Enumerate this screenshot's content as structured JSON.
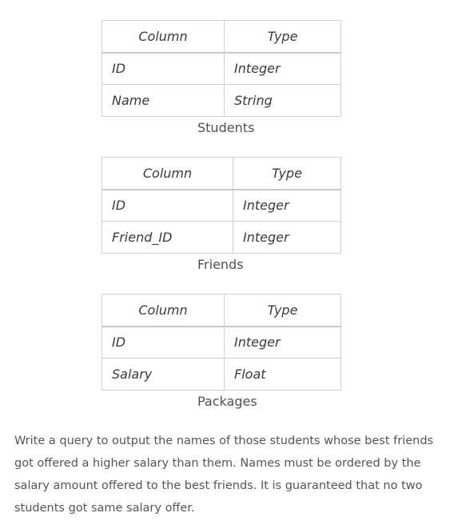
{
  "tables": [
    {
      "header": {
        "column": "Column",
        "type": "Type"
      },
      "rows": [
        {
          "column": "ID",
          "type": "Integer"
        },
        {
          "column": "Name",
          "type": "String"
        }
      ],
      "caption": "Students"
    },
    {
      "header": {
        "column": "Column",
        "type": "Type"
      },
      "rows": [
        {
          "column": "ID",
          "type": "Integer"
        },
        {
          "column": "Friend_ID",
          "type": "Integer"
        }
      ],
      "caption": "Friends"
    },
    {
      "header": {
        "column": "Column",
        "type": "Type"
      },
      "rows": [
        {
          "column": "ID",
          "type": "Integer"
        },
        {
          "column": "Salary",
          "type": "Float"
        }
      ],
      "caption": "Packages"
    }
  ],
  "description": "Write a query to output the names of those students whose best friends got offered a higher salary than them. Names must be ordered by the salary amount offered to the best friends. It is guaranteed that no two students got same salary offer."
}
